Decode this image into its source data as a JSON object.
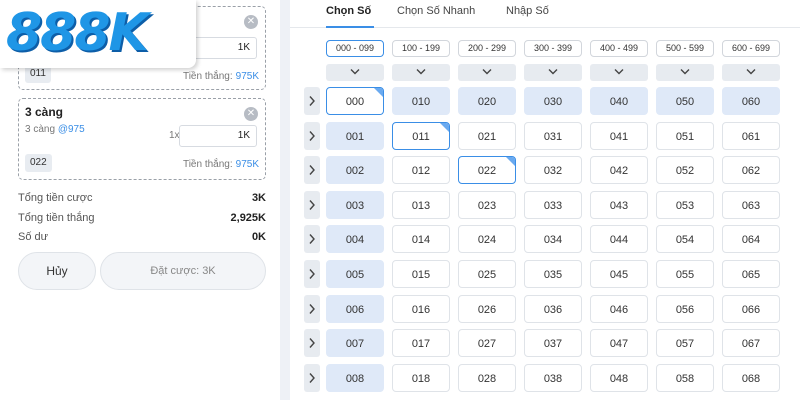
{
  "logo": {
    "text": "888K"
  },
  "slip": {
    "ticket1": {
      "amount": "1K",
      "number": "011",
      "win_label": "Tiền thắng:",
      "win_value": "975K"
    },
    "ticket2": {
      "title": "3 càng",
      "sub_label": "3 càng",
      "sub_odds": "@975",
      "multiplier": "1x",
      "amount": "1K",
      "number": "022",
      "win_label": "Tiền thắng:",
      "win_value": "975K"
    },
    "summary": [
      {
        "label": "Tổng tiền cược",
        "value": "3K"
      },
      {
        "label": "Tổng tiền thắng",
        "value": "2,925K"
      },
      {
        "label": "Số dư",
        "value": "0K"
      }
    ],
    "cancel_label": "Hủy",
    "bet_label": "Đặt cược: 3K"
  },
  "tabs": [
    "Chọn Số",
    "Chọn Số Nhanh",
    "Nhập Số"
  ],
  "active_tab": "Chọn Số",
  "ranges": [
    "000 - 099",
    "100 - 199",
    "200 - 299",
    "300 - 399",
    "400 - 499",
    "500 - 599",
    "600 - 699"
  ],
  "active_range": "000 - 099",
  "grid": [
    [
      "000",
      "010",
      "020",
      "030",
      "040",
      "050",
      "060"
    ],
    [
      "001",
      "011",
      "021",
      "031",
      "041",
      "051",
      "061"
    ],
    [
      "002",
      "012",
      "022",
      "032",
      "042",
      "052",
      "062"
    ],
    [
      "003",
      "013",
      "023",
      "033",
      "043",
      "053",
      "063"
    ],
    [
      "004",
      "014",
      "024",
      "034",
      "044",
      "054",
      "064"
    ],
    [
      "005",
      "015",
      "025",
      "035",
      "045",
      "055",
      "065"
    ],
    [
      "006",
      "016",
      "026",
      "036",
      "046",
      "056",
      "066"
    ],
    [
      "007",
      "017",
      "027",
      "037",
      "047",
      "057",
      "067"
    ],
    [
      "008",
      "018",
      "028",
      "038",
      "048",
      "058",
      "068"
    ]
  ],
  "selected_numbers": [
    "000",
    "011",
    "022"
  ],
  "colors": {
    "accent": "#3a8ee6",
    "highlight": "#dfe9f8",
    "logo_blue": "#1f96e6"
  },
  "icons": {
    "close": "close-icon",
    "chevron_down": "chevron-down-icon",
    "chevron_right": "chevron-right-icon"
  }
}
